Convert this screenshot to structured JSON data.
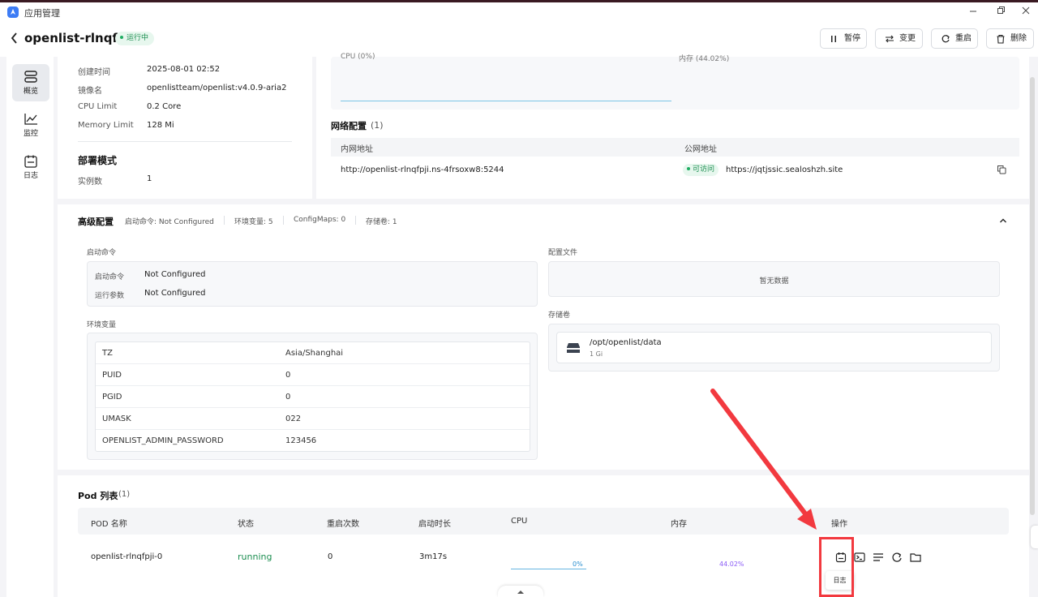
{
  "window": {
    "title": "应用管理"
  },
  "header": {
    "app_name": "openlist-rlnqfpji",
    "status": "运行中",
    "buttons": {
      "pause": "暂停",
      "change": "变更",
      "restart": "重启",
      "delete": "删除"
    }
  },
  "sidebar": {
    "items": [
      {
        "label": "概览"
      },
      {
        "label": "监控"
      },
      {
        "label": "日志"
      }
    ]
  },
  "info": {
    "created_label": "创建时间",
    "created_value": "2025-08-01 02:52",
    "image_label": "镜像名",
    "image_value": "openlistteam/openlist:v4.0.9-aria2",
    "cpu_label": "CPU Limit",
    "cpu_value": "0.2 Core",
    "memory_label": "Memory Limit",
    "memory_value": "128 Mi",
    "deploy_title": "部署模式",
    "instances_label": "实例数",
    "instances_value": "1"
  },
  "monitor": {
    "cpu_label": "CPU (0%)",
    "memory_label": "内存 (44.02%)"
  },
  "network": {
    "title": "网络配置",
    "count": "(1)",
    "col_internal": "内网地址",
    "col_public": "公网地址",
    "internal_address": "http://openlist-rlnqfpji.ns-4frsoxw8:5244",
    "public_status": "可访问",
    "public_address": "https://jqtjssic.sealoshzh.site"
  },
  "advanced": {
    "title": "高级配置",
    "summary": {
      "start_cmd": "启动命令: Not Configured",
      "env_vars": "环境变量: 5",
      "configmaps": "ConfigMaps: 0",
      "volumes": "存储卷: 1"
    },
    "start_section": "启动命令",
    "start_cmd_label": "启动命令",
    "start_cmd_value": "Not Configured",
    "args_label": "运行参数",
    "args_value": "Not Configured",
    "env_section": "环境变量",
    "env": [
      {
        "key": "TZ",
        "value": "Asia/Shanghai"
      },
      {
        "key": "PUID",
        "value": "0"
      },
      {
        "key": "PGID",
        "value": "0"
      },
      {
        "key": "UMASK",
        "value": "022"
      },
      {
        "key": "OPENLIST_ADMIN_PASSWORD",
        "value": "123456"
      }
    ],
    "config_section": "配置文件",
    "config_empty": "暂无数据",
    "volume_section": "存储卷",
    "volume_path": "/opt/openlist/data",
    "volume_size": "1 Gi"
  },
  "pods": {
    "title": "Pod 列表",
    "count": "(1)",
    "columns": [
      "POD 名称",
      "状态",
      "重启次数",
      "启动时长",
      "CPU",
      "内存",
      "操作"
    ],
    "rows": [
      {
        "name": "openlist-rlnqfpji-0",
        "status": "running",
        "restarts": "0",
        "uptime": "3m17s",
        "cpu": "0%",
        "memory": "44.02%",
        "cpu_fraction": 0.0,
        "memory_fraction": 0.4402
      }
    ],
    "tooltip": "日志"
  },
  "colors": {
    "accent": "#1fad62",
    "running": "#1a8d4f",
    "annotation": "#f2393f",
    "memory_text": "#8b5cf6",
    "cpu_text": "#2b8fd0"
  }
}
